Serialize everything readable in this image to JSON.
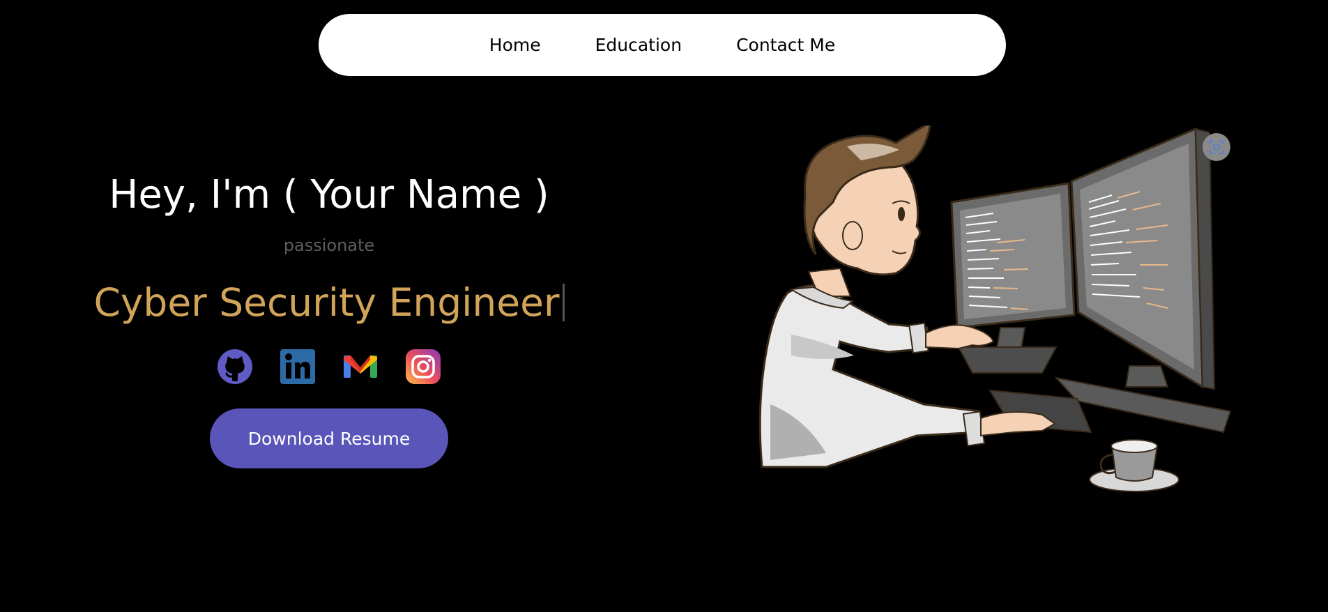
{
  "nav": {
    "items": [
      {
        "label": "Home"
      },
      {
        "label": "Education"
      },
      {
        "label": "Contact Me"
      }
    ]
  },
  "hero": {
    "greeting": "Hey, I'm ( Your Name )",
    "subtitle": "passionate",
    "role": "Cyber Security Engineer",
    "role_color": "#d2a45a",
    "download_button": "Download Resume",
    "button_color": "#5a55b8"
  },
  "socials": [
    {
      "icon": "github-icon"
    },
    {
      "icon": "linkedin-icon"
    },
    {
      "icon": "gmail-icon"
    },
    {
      "icon": "instagram-icon"
    }
  ],
  "illustration": {
    "icon": "developer-at-computer-illustration",
    "overlay_icon": "image-search-icon"
  },
  "colors": {
    "background": "#000000",
    "nav_background": "#ffffff"
  }
}
